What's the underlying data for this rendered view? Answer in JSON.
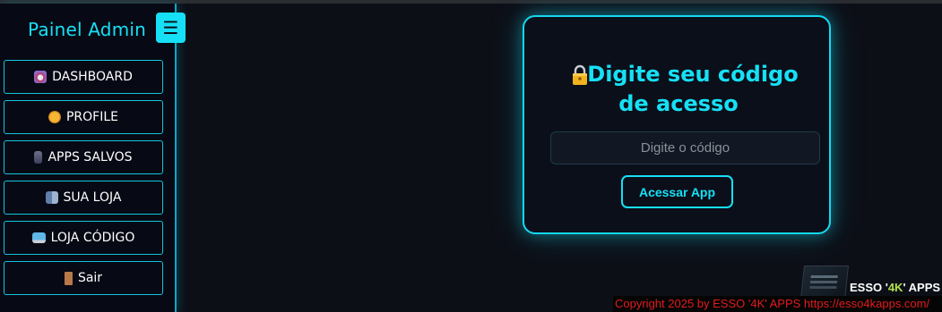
{
  "sidebar": {
    "title": "Painel Admin",
    "toggle_label": "☰",
    "items": [
      {
        "label": "DASHBOARD",
        "icon": "robot-icon"
      },
      {
        "label": "PROFILE",
        "icon": "face-icon"
      },
      {
        "label": "APPS SALVOS",
        "icon": "phone-icon"
      },
      {
        "label": "SUA LOJA",
        "icon": "store-icon"
      },
      {
        "label": "LOJA CÓDIGO",
        "icon": "laptop-icon"
      },
      {
        "label": "Sair",
        "icon": "door-icon"
      }
    ]
  },
  "access_card": {
    "title": "Digite seu código de acesso",
    "icon": "lock-icon",
    "input_placeholder": "Digite o código",
    "input_value": "",
    "button_label": "Acessar App"
  },
  "brand_logo": {
    "text_prefix": "ESSO '",
    "text_highlight": "4K",
    "text_suffix": "' APPS"
  },
  "footer": {
    "copyright": "Copyright 2025  by ESSO '4K' APPS https://esso4kapps.com/"
  },
  "colors": {
    "accent": "#16e0f5",
    "background": "#0d0f17",
    "sidebar_bg": "#070914",
    "copyright_text": "#e31b1b"
  }
}
